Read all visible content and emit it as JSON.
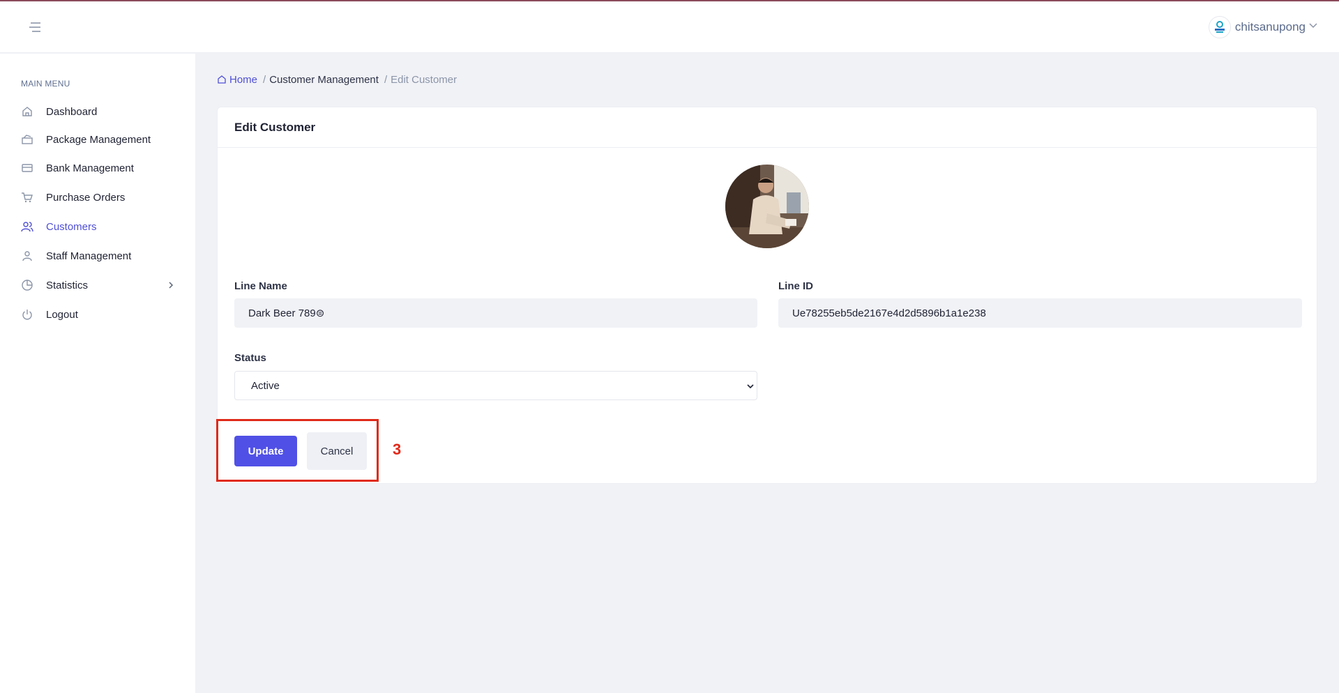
{
  "header": {
    "menu_icon": "hamburger-icon",
    "user": {
      "name": "chitsanupong",
      "avatar_icon": "user-avatar-logo",
      "dropdown_icon": "chevron-down-icon"
    }
  },
  "sidebar": {
    "title": "MAIN MENU",
    "items": [
      {
        "label": "Dashboard",
        "icon": "home-icon",
        "active": false
      },
      {
        "label": "Package Management",
        "icon": "package-icon",
        "active": false
      },
      {
        "label": "Bank Management",
        "icon": "credit-card-icon",
        "active": false
      },
      {
        "label": "Purchase Orders",
        "icon": "cart-icon",
        "active": false
      },
      {
        "label": "Customers",
        "icon": "users-icon",
        "active": true
      },
      {
        "label": "Staff Management",
        "icon": "user-icon",
        "active": false
      },
      {
        "label": "Statistics",
        "icon": "pie-chart-icon",
        "active": false,
        "has_submenu": true
      },
      {
        "label": "Logout",
        "icon": "power-icon",
        "active": false
      }
    ]
  },
  "breadcrumb": {
    "home": "Home",
    "sep1": "/",
    "section": "Customer Management",
    "sep2": "/",
    "current": "Edit Customer"
  },
  "card": {
    "title": "Edit Customer",
    "line_name_label": "Line Name",
    "line_name_value": "Dark Beer 789⊜",
    "line_id_label": "Line ID",
    "line_id_value": "Ue78255eb5de2167e4d2d5896b1a1e238",
    "status_label": "Status",
    "status_value": "Active",
    "update_label": "Update",
    "cancel_label": "Cancel"
  },
  "annotation": {
    "step": "3"
  },
  "colors": {
    "accent": "#5050e6",
    "highlight": "#e02a1a",
    "background": "#f1f2f6"
  }
}
